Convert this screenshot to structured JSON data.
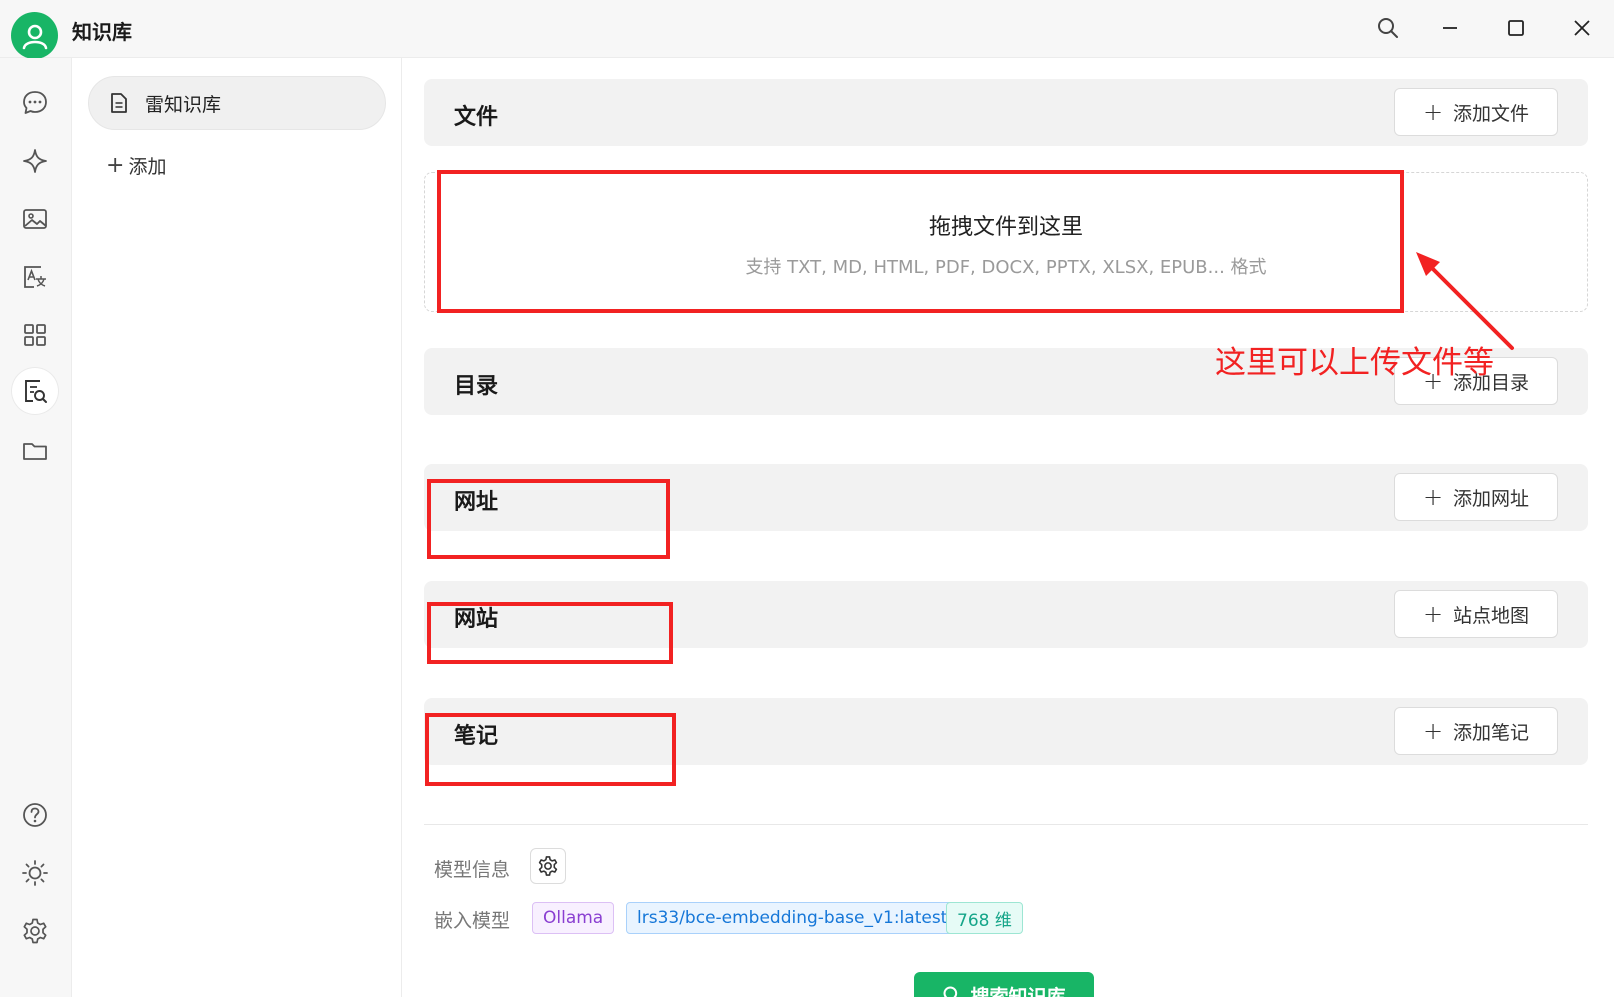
{
  "app": {
    "title": "知识库"
  },
  "sidebar": {
    "rail_items": [
      {
        "icon": "chat-icon"
      },
      {
        "icon": "sparkle-icon"
      },
      {
        "icon": "image-icon"
      },
      {
        "icon": "translate-icon"
      },
      {
        "icon": "apps-icon"
      },
      {
        "icon": "knowledge-search-icon",
        "active": true
      },
      {
        "icon": "folder-icon"
      }
    ],
    "bottom_items": [
      {
        "icon": "help-icon"
      },
      {
        "icon": "theme-icon"
      },
      {
        "icon": "settings-icon"
      }
    ]
  },
  "kb_list": {
    "items": [
      {
        "label": "雷知识库",
        "icon": "document-icon"
      }
    ],
    "add_label": "添加"
  },
  "sections": {
    "files": {
      "title": "文件",
      "button": "添加文件"
    },
    "directory": {
      "title": "目录",
      "button": "添加目录"
    },
    "url": {
      "title": "网址",
      "button": "添加网址"
    },
    "website": {
      "title": "网站",
      "button": "站点地图"
    },
    "notes": {
      "title": "笔记",
      "button": "添加笔记"
    }
  },
  "dropzone": {
    "title": "拖拽文件到这里",
    "subtitle": "支持 TXT, MD, HTML, PDF, DOCX, PPTX, XLSX, EPUB... 格式"
  },
  "model": {
    "info_label": "模型信息",
    "embed_label": "嵌入模型",
    "provider": "Ollama",
    "model_name": "lrs33/bce-embedding-base_v1:latest",
    "dimensions": "768 维"
  },
  "search_button": "搜索知识库",
  "annotation": {
    "text": "这里可以上传文件等",
    "color": "#f22222"
  },
  "colors": {
    "brand": "#18b566",
    "annotation": "#f22222"
  }
}
